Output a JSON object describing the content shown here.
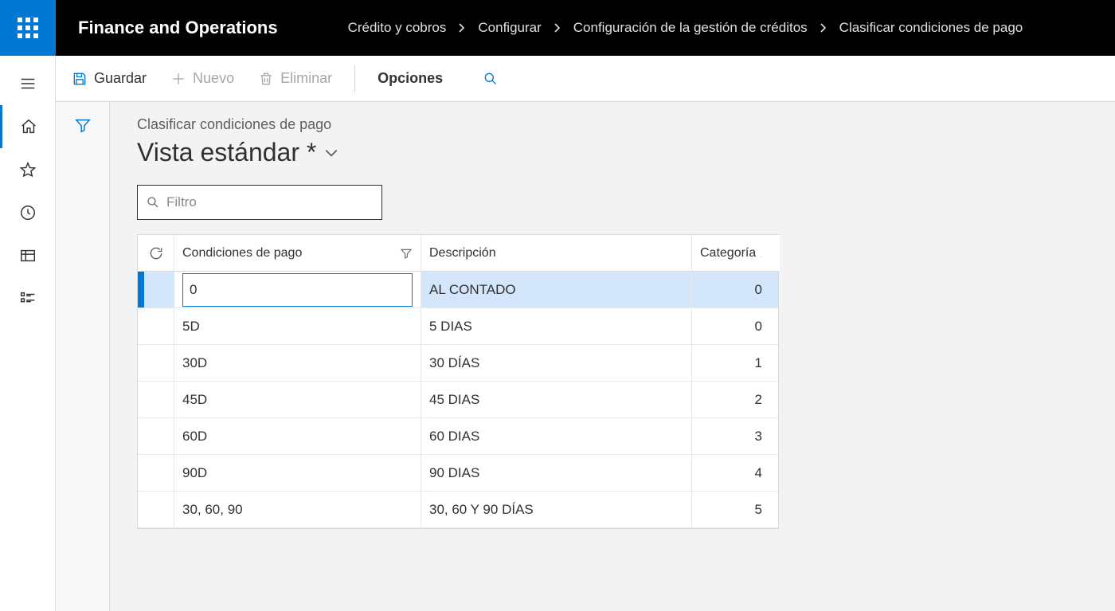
{
  "header": {
    "app_title": "Finance and Operations",
    "breadcrumbs": [
      "Crédito y cobros",
      "Configurar",
      "Configuración de la gestión de créditos",
      "Clasificar condiciones de pago"
    ]
  },
  "actionbar": {
    "save": "Guardar",
    "new": "Nuevo",
    "delete": "Eliminar",
    "options": "Opciones"
  },
  "page": {
    "subtitle": "Clasificar condiciones de pago",
    "view_name": "Vista estándar *",
    "filter_placeholder": "Filtro"
  },
  "grid": {
    "columns": {
      "terms": "Condiciones de pago",
      "description": "Descripción",
      "category": "Categoría"
    },
    "rows": [
      {
        "terms": "0",
        "description": "AL CONTADO",
        "category": "0",
        "selected": true
      },
      {
        "terms": "5D",
        "description": "5 DIAS",
        "category": "0",
        "selected": false
      },
      {
        "terms": "30D",
        "description": "30 DÍAS",
        "category": "1",
        "selected": false
      },
      {
        "terms": "45D",
        "description": "45 DIAS",
        "category": "2",
        "selected": false
      },
      {
        "terms": "60D",
        "description": "60 DIAS",
        "category": "3",
        "selected": false
      },
      {
        "terms": "90D",
        "description": "90 DIAS",
        "category": "4",
        "selected": false
      },
      {
        "terms": "30, 60, 90",
        "description": "30, 60 Y 90 DÍAS",
        "category": "5",
        "selected": false
      }
    ]
  }
}
